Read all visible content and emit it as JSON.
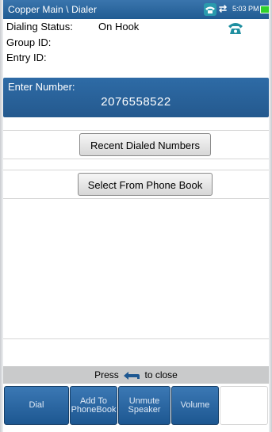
{
  "titlebar": {
    "title": "Copper Main \\ Dialer",
    "time": "5:03 PM",
    "sync_glyph": "⇄",
    "phone_icon": "phone-status-icon",
    "battery_color": "#2fd12c"
  },
  "status": {
    "dialing_label": "Dialing Status:",
    "dialing_value": "On Hook",
    "group_label": "Group ID:",
    "entry_label": "Entry ID:",
    "hook_icon": "phone-on-hook-icon"
  },
  "enter_number": {
    "label": "Enter Number:",
    "value": "2076558522"
  },
  "buttons": {
    "recent": "Recent Dialed Numbers",
    "phonebook": "Select From Phone Book"
  },
  "footer": {
    "press_prefix": "Press",
    "press_suffix": "to close",
    "tabs": [
      {
        "label": "Dial"
      },
      {
        "label": "Add To PhoneBook"
      },
      {
        "label": "Unmute Speaker"
      },
      {
        "label": "Volume"
      }
    ]
  },
  "colors": {
    "header_blue": "#2e6ba6",
    "accent_teal": "#1f8fa0"
  }
}
